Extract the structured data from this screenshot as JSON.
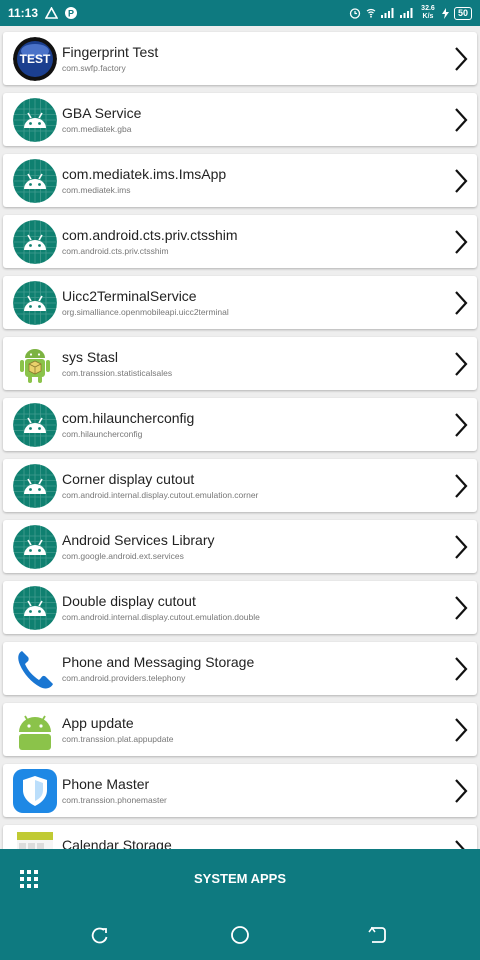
{
  "status_bar": {
    "time": "11:13",
    "net_speed": "32.6 K/s",
    "battery": "50",
    "left_icons": [
      "warning-icon",
      "p-icon"
    ],
    "right_icons": [
      "alarm-icon",
      "wifi-icon",
      "signal-icon",
      "signal-icon"
    ]
  },
  "apps": [
    {
      "name": "Fingerprint Test",
      "package": "com.swfp.factory",
      "icon": "test-icon"
    },
    {
      "name": "GBA Service",
      "package": "com.mediatek.gba",
      "icon": "android-icon"
    },
    {
      "name": "com.mediatek.ims.ImsApp",
      "package": "com.mediatek.ims",
      "icon": "android-icon"
    },
    {
      "name": "com.android.cts.priv.ctsshim",
      "package": "com.android.cts.priv.ctsshim",
      "icon": "android-icon"
    },
    {
      "name": "Uicc2TerminalService",
      "package": "org.simalliance.openmobileapi.uicc2terminal",
      "icon": "android-icon"
    },
    {
      "name": "sys Stasl",
      "package": "com.transsion.statisticalsales",
      "icon": "robot-box-icon"
    },
    {
      "name": "com.hilauncherconfig",
      "package": "com.hilauncherconfig",
      "icon": "android-icon"
    },
    {
      "name": "Corner display cutout",
      "package": "com.android.internal.display.cutout.emulation.corner",
      "icon": "android-icon"
    },
    {
      "name": "Android Services Library",
      "package": "com.google.android.ext.services",
      "icon": "android-icon"
    },
    {
      "name": "Double display cutout",
      "package": "com.android.internal.display.cutout.emulation.double",
      "icon": "android-icon"
    },
    {
      "name": "Phone and Messaging Storage",
      "package": "com.android.providers.telephony",
      "icon": "phone-icon"
    },
    {
      "name": "App update",
      "package": "com.transsion.plat.appupdate",
      "icon": "android-head-icon"
    },
    {
      "name": "Phone Master",
      "package": "com.transsion.phonemaster",
      "icon": "shield-icon"
    },
    {
      "name": "Calendar Storage",
      "package": "",
      "icon": "calendar-icon"
    }
  ],
  "bottom_bar": {
    "title": "SYSTEM APPS",
    "icon": "grid-icon"
  },
  "nav": {
    "icons": [
      "recents-icon",
      "home-icon",
      "back-icon"
    ]
  },
  "colors": {
    "accent": "#0e7a80",
    "android_icon_bg": "#0f8070",
    "card_bg": "#ffffff",
    "page_bg": "#eeeeee"
  }
}
